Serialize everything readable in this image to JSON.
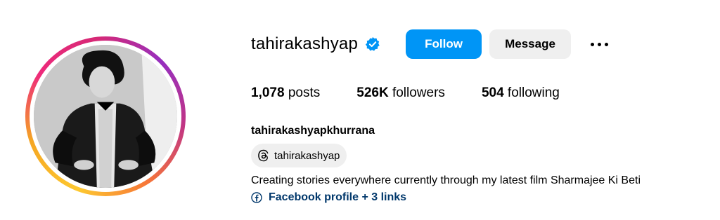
{
  "profile": {
    "username": "tahirakashyap",
    "full_name": "tahirakashyapkhurrana",
    "verified_icon": "verified-badge-icon",
    "threads_handle": "tahirakashyap",
    "bio": "Creating stories everywhere currently through my latest film Sharmajee Ki Beti",
    "links_label": "Facebook profile + 3 links"
  },
  "actions": {
    "follow_label": "Follow",
    "message_label": "Message"
  },
  "stats": {
    "posts_count": "1,078",
    "posts_label": "posts",
    "followers_count": "526K",
    "followers_label": "followers",
    "following_count": "504",
    "following_label": "following"
  },
  "colors": {
    "follow_blue": "#0095f6",
    "link_blue": "#00376b",
    "button_gray": "#efefef"
  }
}
